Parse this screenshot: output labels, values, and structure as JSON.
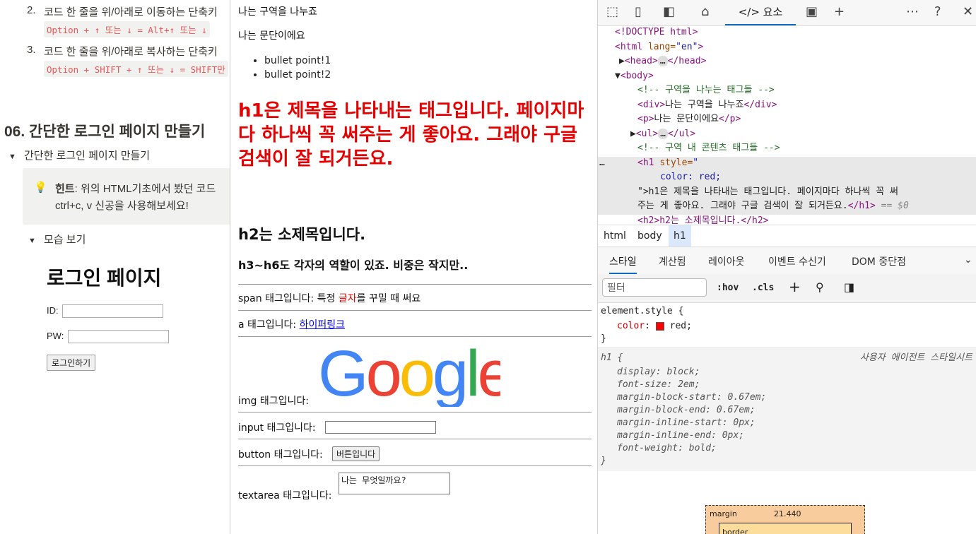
{
  "notion": {
    "list_item_2_num": "2.",
    "list_item_2_text": "코드 한 줄을 위/아래로 이동하는 단축키",
    "list_item_2_code": "Option + ↑ 또는 ↓ = Alt+↑ 또는 ↓",
    "list_item_3_num": "3.",
    "list_item_3_text": "코드 한 줄을 위/아래로 복사하는 단축키",
    "list_item_3_code": "Option + SHIFT + ↑ 또는 ↓ = SHIFT만",
    "section_title": "06. 간단한 로그인 페이지 만들기",
    "toggle1": "간단한 로그인 페이지 만들기",
    "hint_bold": "힌트",
    "hint_line1": ": 위의 HTML기초에서 봤던 코드",
    "hint_line2": "ctrl+c, v 신공을 사용해보세요!",
    "toggle2": "모습 보기",
    "demo_title": "로그인 페이지",
    "id_label": "ID:",
    "pw_label": "PW:",
    "login_button": "로그인하기"
  },
  "page": {
    "div_text": "나는 구역을 나누죠",
    "p_text": "나는 문단이에요",
    "bullets": [
      "bullet point!1",
      "bullet point!2"
    ],
    "h1_text": "h1은 제목을 나타내는 태그입니다. 페이지마다 하나씩 꼭 써주는 게 좋아요. 그래야 구글 검색이 잘 되거든요.",
    "h2_text": "h2는 소제목입니다.",
    "h3_text": "h3~h6도 각자의 역할이 있죠. 비중은 작지만..",
    "span_pre": "span 태그입니다: 특정 ",
    "span_red": "글자",
    "span_post": "를 꾸밀 때 써요",
    "a_pre": "a 태그입니다: ",
    "a_link": "하이퍼링크",
    "img_label": "img 태그입니다:",
    "google_logo": "Google",
    "input_label": "input 태그입니다:",
    "button_label": "button 태그입니다:",
    "button_text": "버튼입니다",
    "textarea_label": "textarea 태그입니다:",
    "textarea_value": "나는 무엇일까요?"
  },
  "devtools": {
    "tab_elements": "</> 요소",
    "dom": {
      "doctype": "<!DOCTYPE html>",
      "html_open": "<html",
      "lang_attr": " lang=",
      "lang_val": "\"en\"",
      "gt": ">",
      "head": "<head>",
      "head_close": "</head>",
      "body": "<body>",
      "comment1": "<!-- 구역을 나누는 태그들 -->",
      "div_open": "<div>",
      "div_text": "나는 구역을 나누죠",
      "div_close": "</div>",
      "p_open": "<p>",
      "p_text": "나는 문단이에요",
      "p_close": "</p>",
      "ul_open": "<ul>",
      "ul_close": "</ul>",
      "comment2": "<!-- 구역 내 콘텐츠 태그들 -->",
      "h1_open": "<h1 ",
      "style_attr": "style=",
      "style_quote": "\"",
      "style_val": "color: red;",
      "h1_text_line1": "\">h1은 제목을 나타내는 태그입니다. 페이지마다 하나씩 꼭 써",
      "h1_text_line2": "주는 게 좋아요. 그래야 구글 검색이 잘 되거든요.",
      "h1_close": "</h1>",
      "eq_ref": " == $0",
      "h2_line": "<h2>h2는 소제목입니다.</h2>"
    },
    "breadcrumbs": [
      "html",
      "body",
      "h1"
    ],
    "style_tabs": [
      "스타일",
      "계산됨",
      "레이아웃",
      "이벤트 수신기",
      "DOM 중단점"
    ],
    "filter_placeholder": "필터",
    "hov": ":hov",
    "cls": ".cls",
    "element_style": "element.style {",
    "color_prop": "color",
    "color_val": "red;",
    "close_brace": "}",
    "h1_selector": "h1 {",
    "ua_label": "사용자 에이전트 스타일시트",
    "ua_rules": [
      [
        "display",
        "block;"
      ],
      [
        "font-size",
        "2em;"
      ],
      [
        "margin-block-start",
        "0.67em;"
      ],
      [
        "margin-block-end",
        "0.67em;"
      ],
      [
        "margin-inline-start",
        "0px;"
      ],
      [
        "margin-inline-end",
        "0px;"
      ],
      [
        "font-weight",
        "bold;"
      ]
    ],
    "box_margin_label": "margin",
    "box_margin_value": "21.440",
    "box_border_label": "border",
    "colors": {
      "accent": "#0f6cbd",
      "swatch": "#ff0000"
    }
  }
}
